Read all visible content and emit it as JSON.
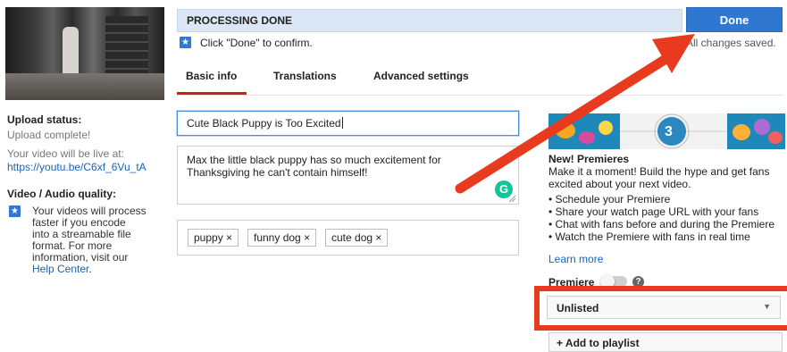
{
  "header": {
    "processing_text": "PROCESSING DONE",
    "done_label": "Done",
    "confirm_text": "Click \"Done\" to confirm.",
    "saved_text": "All changes saved."
  },
  "tabs": [
    {
      "label": "Basic info",
      "active": true
    },
    {
      "label": "Translations",
      "active": false
    },
    {
      "label": "Advanced settings",
      "active": false
    }
  ],
  "left": {
    "upload_status_label": "Upload status:",
    "upload_status_value": "Upload complete!",
    "live_label": "Your video will be live at:",
    "live_url": "https://youtu.be/C6xf_6Vu_tA",
    "quality_label": "Video / Audio quality:",
    "quality_lines": [
      "Your videos will process",
      "faster if you encode",
      "into a streamable file",
      "format. For more",
      "information, visit our"
    ],
    "help_center": "Help Center",
    "help_center_suffix": "."
  },
  "form": {
    "title": "Cute Black Puppy is Too Excited",
    "description_lines": [
      "Max the little black puppy has so much excitement for",
      "Thanksgiving he can't contain himself!"
    ],
    "tags": [
      "puppy",
      "funny dog",
      "cute dog"
    ],
    "tag_remove": "×",
    "grammarly_letter": "G"
  },
  "premieres": {
    "banner_number": "3",
    "title": "New! Premieres",
    "intro": "Make it a moment! Build the hype and get fans excited about your next video.",
    "bullets": [
      "• Schedule your Premiere",
      "• Share your watch page URL with your fans",
      "• Chat with fans before and during the Premiere",
      "• Watch the Premiere with fans in real time"
    ],
    "learn_more": "Learn more",
    "label": "Premiere",
    "help": "?"
  },
  "visibility": {
    "value": "Unlisted",
    "chevron": "▼"
  },
  "playlist": {
    "label": "+ Add to playlist"
  },
  "colors": {
    "accent_blue": "#2f77d1",
    "annotation_red": "#e83a1f",
    "tab_red": "#cc2020"
  }
}
